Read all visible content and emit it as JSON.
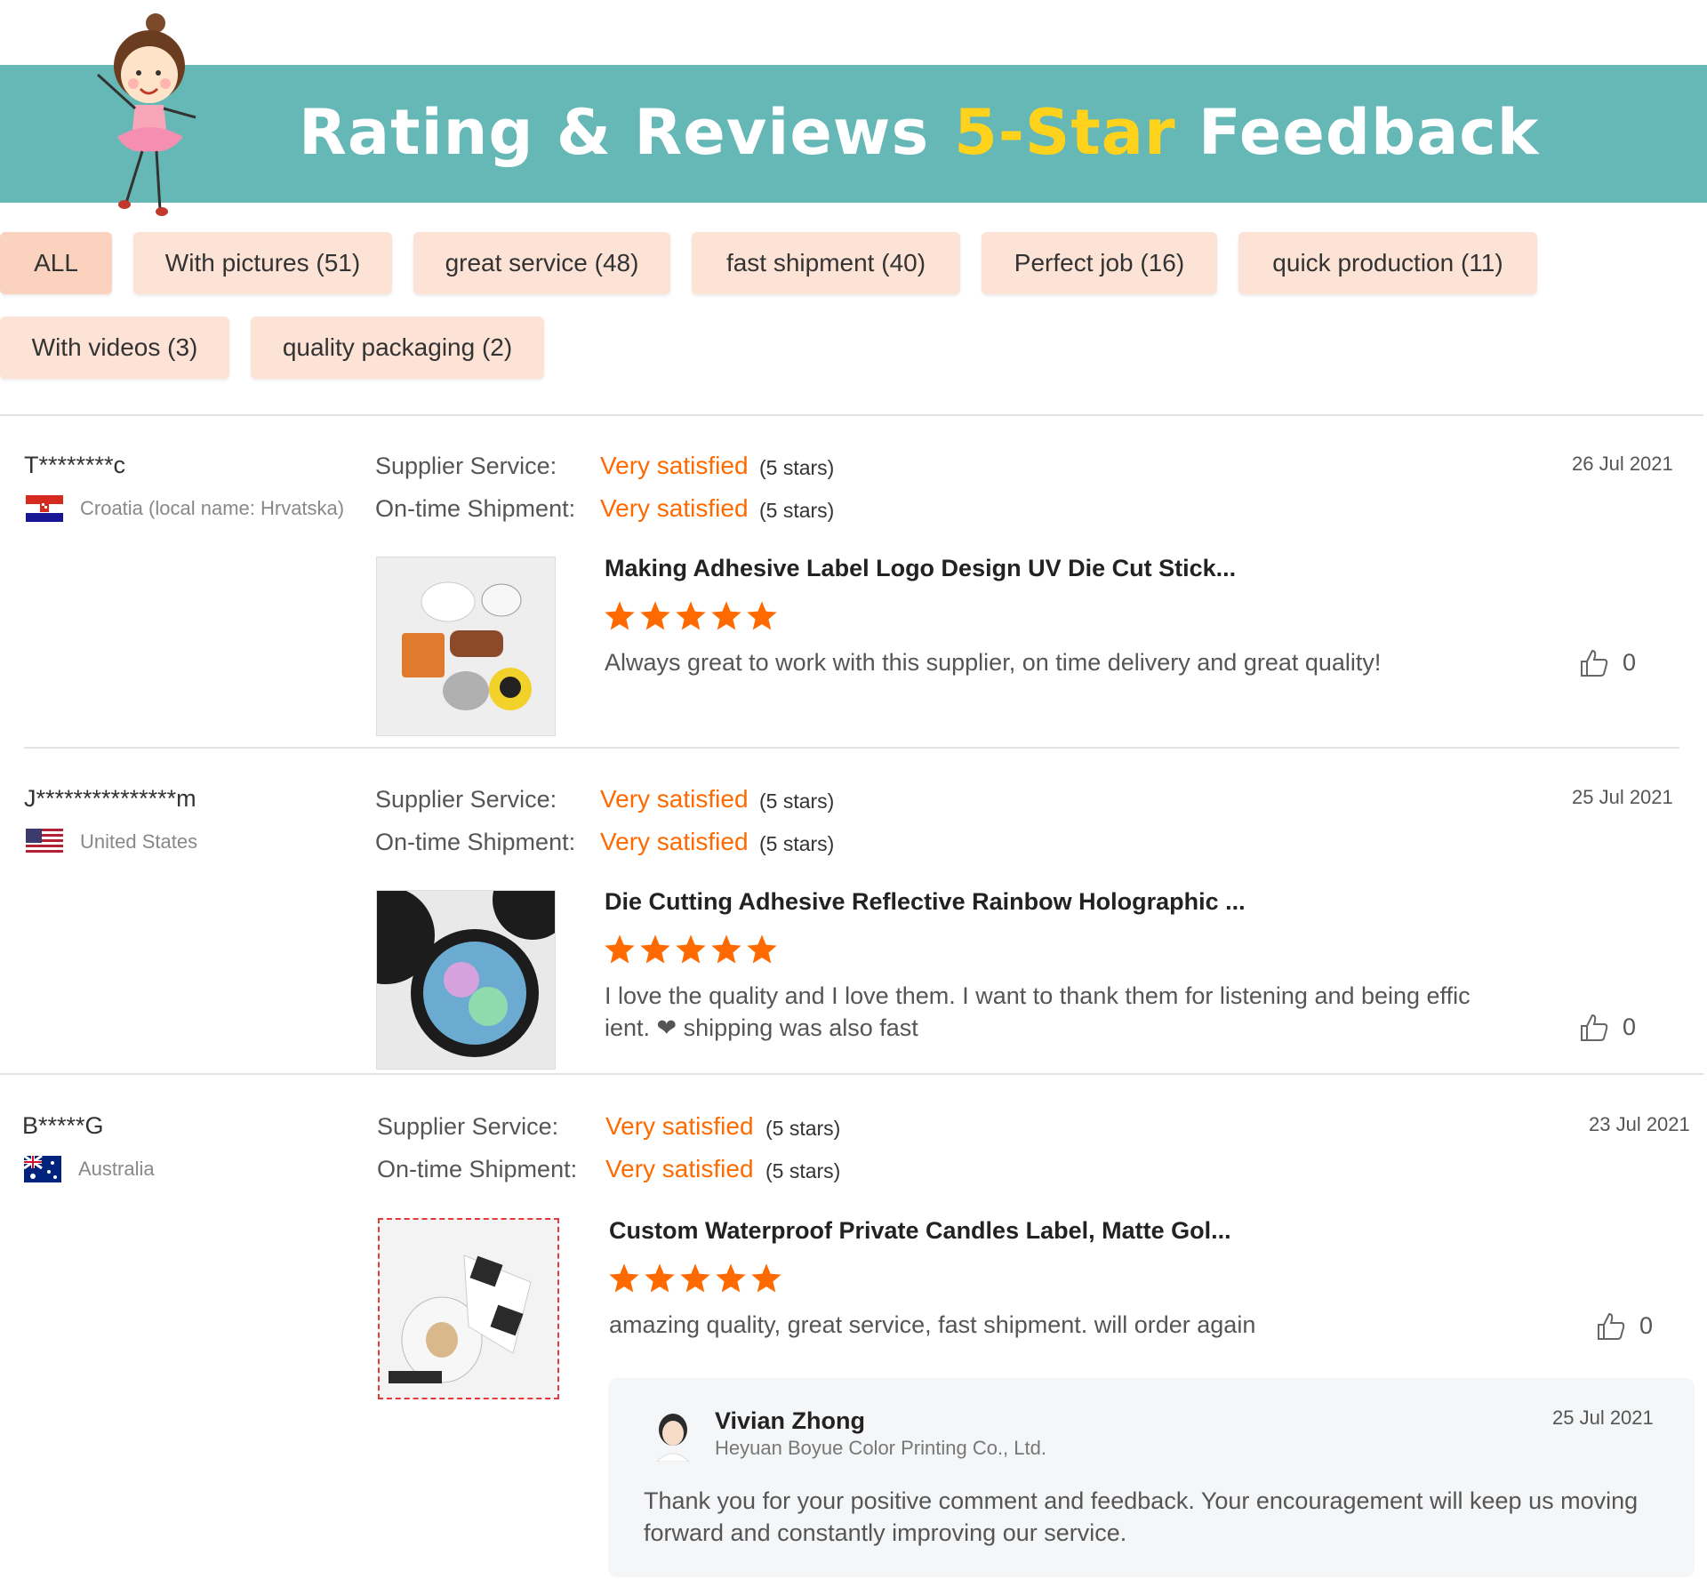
{
  "banner": {
    "title": "Rating & Reviews",
    "highlight": "5-Star",
    "suffix": "Feedback"
  },
  "filters": [
    {
      "label": "ALL"
    },
    {
      "label": "With pictures (51)"
    },
    {
      "label": "great service (48)"
    },
    {
      "label": "fast shipment (40)"
    },
    {
      "label": "Perfect job (16)"
    },
    {
      "label": "quick production (11)"
    },
    {
      "label": "With videos (3)"
    },
    {
      "label": "quality packaging (2)"
    }
  ],
  "labels": {
    "supplier_service": "Supplier Service:",
    "ontime_shipment": "On-time Shipment:"
  },
  "reviews": [
    {
      "reviewer": "T********c",
      "country": "Croatia (local name: Hrvatska)",
      "flag_icon": "croatia-flag-icon",
      "supplier_rating": "Very satisfied",
      "supplier_stars": "(5 stars)",
      "shipment_rating": "Very satisfied",
      "shipment_stars": "(5 stars)",
      "date": "26 Jul 2021",
      "product_title": "Making Adhesive Label Logo Design UV Die Cut Stick...",
      "stars": 5,
      "text": "Always great to work with this supplier, on time delivery and great quality!",
      "likes": "0"
    },
    {
      "reviewer": "J***************m",
      "country": "United States",
      "flag_icon": "usa-flag-icon",
      "supplier_rating": "Very satisfied",
      "supplier_stars": "(5 stars)",
      "shipment_rating": "Very satisfied",
      "shipment_stars": "(5 stars)",
      "date": "25 Jul 2021",
      "product_title": "Die Cutting Adhesive Reflective Rainbow Holographic ...",
      "stars": 5,
      "text": "I love the quality and I love them. I want to thank them for listening and being effic ient. ❤ shipping was also fast",
      "likes": "0"
    },
    {
      "reviewer": "B*****G",
      "country": "Australia",
      "flag_icon": "australia-flag-icon",
      "supplier_rating": "Very satisfied",
      "supplier_stars": "(5 stars)",
      "shipment_rating": "Very satisfied",
      "shipment_stars": "(5 stars)",
      "date": "23 Jul 2021",
      "product_title": "Custom Waterproof Private Candles Label, Matte Gol...",
      "stars": 5,
      "text": "amazing quality, great service, fast shipment. will order again",
      "likes": "0"
    }
  ],
  "reply": {
    "name": "Vivian Zhong",
    "company": "Heyuan Boyue Color Printing Co., Ltd.",
    "date": "25 Jul 2021",
    "text": "Thank you for your positive comment and feedback. Your encouragement will keep us moving forward and constantly improving our service."
  },
  "colors": {
    "banner": "#66b8b7",
    "highlight": "#ffd21c",
    "rating": "#ff6a00",
    "chip": "#fde3d6"
  }
}
